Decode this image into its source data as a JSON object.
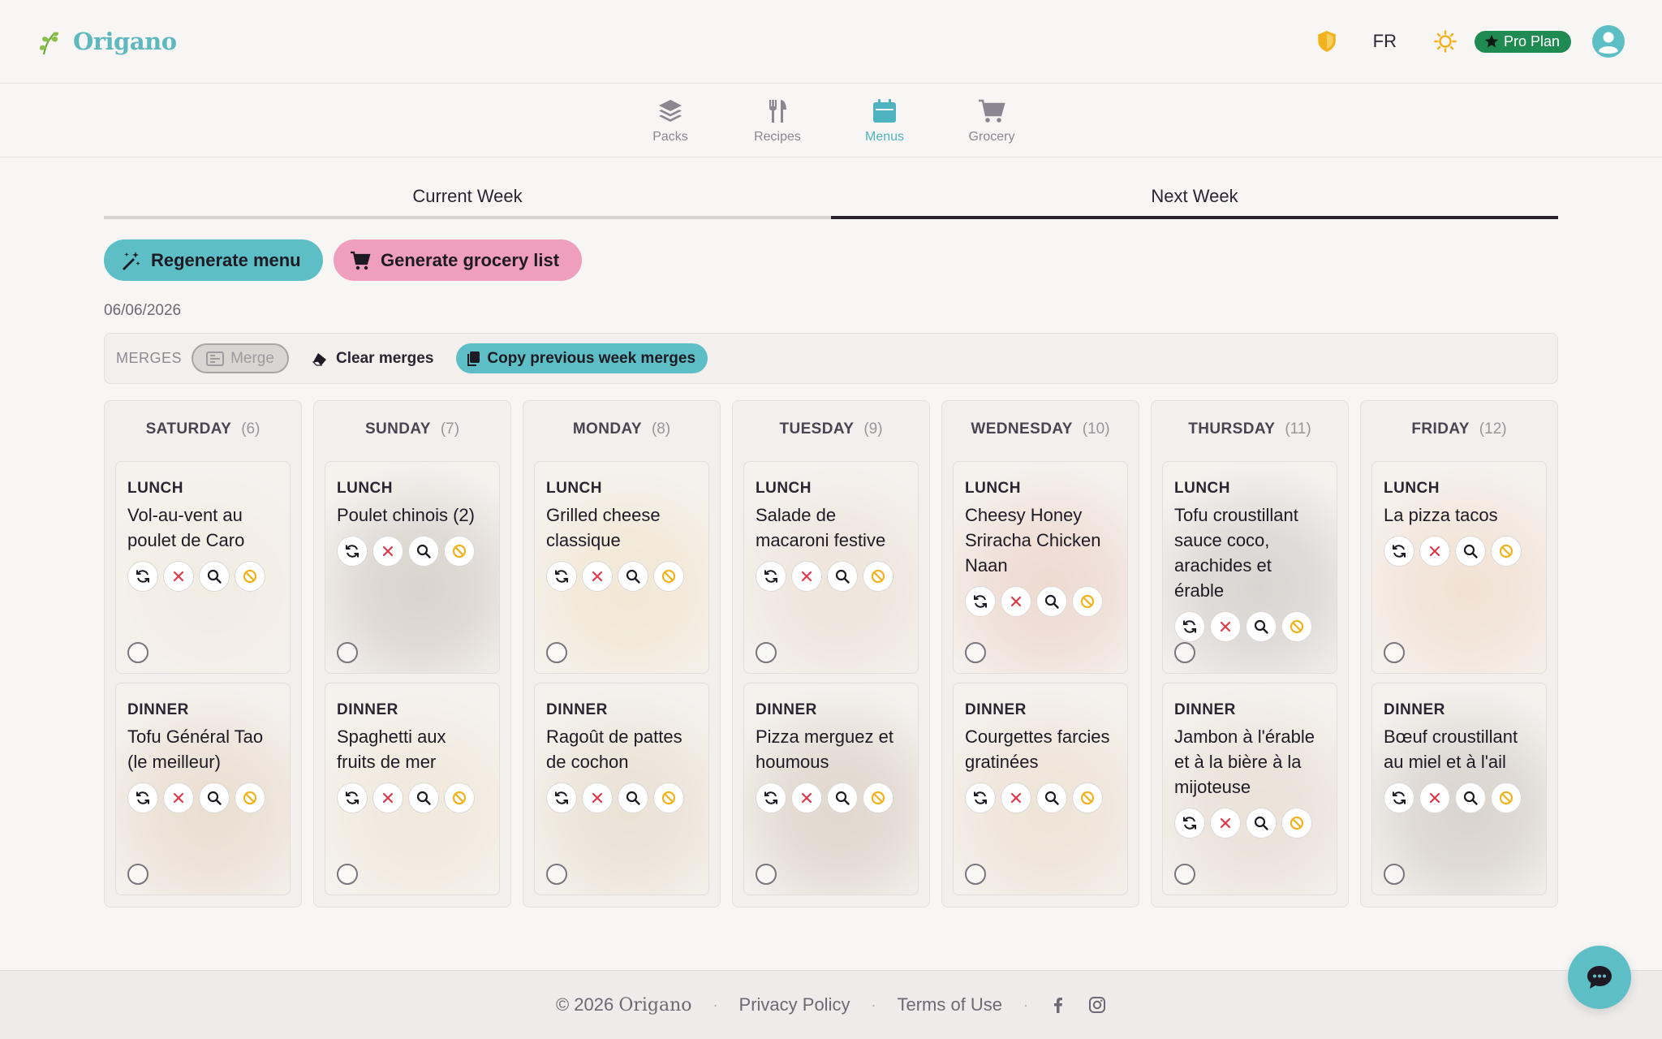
{
  "app": {
    "name": "Origano"
  },
  "header": {
    "language": "FR",
    "plan_label": "Pro Plan"
  },
  "nav": {
    "items": [
      {
        "label": "Packs",
        "icon": "layers-icon",
        "active": false
      },
      {
        "label": "Recipes",
        "icon": "utensils-icon",
        "active": false
      },
      {
        "label": "Menus",
        "icon": "calendar-icon",
        "active": true
      },
      {
        "label": "Grocery",
        "icon": "cart-icon",
        "active": false
      }
    ]
  },
  "week_tabs": [
    {
      "label": "Current Week",
      "active": false
    },
    {
      "label": "Next Week",
      "active": true
    }
  ],
  "actions": {
    "regenerate_label": "Regenerate menu",
    "grocery_label": "Generate grocery list"
  },
  "date": "06/06/2026",
  "merges": {
    "label": "MERGES",
    "merge_label": "Merge",
    "clear_label": "Clear merges",
    "copy_label": "Copy previous week merges"
  },
  "days": [
    {
      "name": "SATURDAY",
      "num": "(6)",
      "lunch": {
        "type": "LUNCH",
        "name": "Vol-au-vent au poulet de Caro",
        "bg": "#d9c9a8"
      },
      "dinner": {
        "type": "DINNER",
        "name": "Tofu Général Tao (le meilleur)",
        "bg": "#b88a5a"
      }
    },
    {
      "name": "SUNDAY",
      "num": "(7)",
      "lunch": {
        "type": "LUNCH",
        "name": "Poulet chinois (2)",
        "bg": "#6e5a4a"
      },
      "dinner": {
        "type": "DINNER",
        "name": "Spaghetti aux fruits de mer",
        "bg": "#d4b88a"
      }
    },
    {
      "name": "MONDAY",
      "num": "(8)",
      "lunch": {
        "type": "LUNCH",
        "name": "Grilled cheese classique",
        "bg": "#d8b46a"
      },
      "dinner": {
        "type": "DINNER",
        "name": "Ragoût de pattes de cochon",
        "bg": "#b89a6a"
      }
    },
    {
      "name": "TUESDAY",
      "num": "(9)",
      "lunch": {
        "type": "LUNCH",
        "name": "Salade de macaroni festive",
        "bg": "#c8a888"
      },
      "dinner": {
        "type": "DINNER",
        "name": "Pizza merguez et houmous",
        "bg": "#8a6a4a"
      }
    },
    {
      "name": "WEDNESDAY",
      "num": "(10)",
      "lunch": {
        "type": "LUNCH",
        "name": "Cheesy Honey Sriracha Chicken Naan",
        "bg": "#c47a5a"
      },
      "dinner": {
        "type": "DINNER",
        "name": "Courgettes farcies gratinées",
        "bg": "#c8a070"
      }
    },
    {
      "name": "THURSDAY",
      "num": "(11)",
      "lunch": {
        "type": "LUNCH",
        "name": "Tofu croustillant sauce coco, arachides et érable",
        "bg": "#6a6058"
      },
      "dinner": {
        "type": "DINNER",
        "name": "Jambon à l'érable et à la bière à la mijoteuse",
        "bg": "#b89878"
      }
    },
    {
      "name": "FRIDAY",
      "num": "(12)",
      "lunch": {
        "type": "LUNCH",
        "name": "La pizza tacos",
        "bg": "#d89a6a"
      },
      "dinner": {
        "type": "DINNER",
        "name": "Bœuf croustillant au miel et à l'ail",
        "bg": "#6a5a4a"
      }
    }
  ],
  "footer": {
    "copyright_prefix": "© 2026",
    "brand": "Origano",
    "privacy": "Privacy Policy",
    "terms": "Terms of Use"
  },
  "colors": {
    "teal": "#5dbfc5",
    "pink": "#ef9fbd",
    "pro_green": "#1f8a52",
    "shield": "#f2b21e",
    "sun": "#f2b21e",
    "delete_red": "#e0394a",
    "ban_yellow": "#f2b21e"
  }
}
